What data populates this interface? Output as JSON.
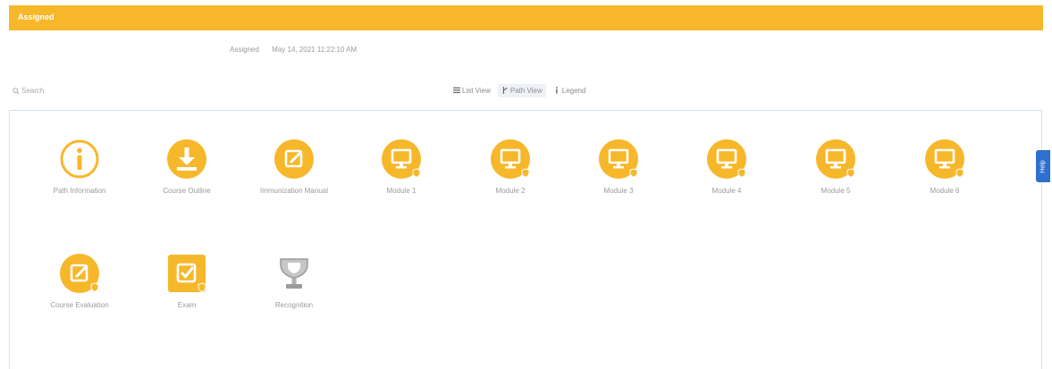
{
  "header": {
    "title": "Assigned"
  },
  "assigned": {
    "label": "Assigned",
    "value": "May 14, 2021 11:22:10 AM"
  },
  "search": {
    "placeholder": "Search"
  },
  "view_options": [
    {
      "label": "List View",
      "icon": "list-icon"
    },
    {
      "label": "Path View",
      "icon": "path-icon",
      "active": true
    },
    {
      "label": "Legend",
      "icon": "legend-icon"
    }
  ],
  "help": {
    "label": "Help"
  },
  "colors": {
    "accent": "#f7b72a",
    "help": "#2f6fcf",
    "trophy": "#b8b8b8"
  },
  "path_items": [
    {
      "label": "Path Information",
      "icon": "info-icon"
    },
    {
      "label": "Course Outline",
      "icon": "download-icon"
    },
    {
      "label": "Immunization Manual",
      "icon": "edit-icon"
    },
    {
      "label": "Module 1",
      "icon": "monitor-icon",
      "badge": "required-badge"
    },
    {
      "label": "Module 2",
      "icon": "monitor-icon",
      "badge": "required-badge"
    },
    {
      "label": "Module 3",
      "icon": "monitor-icon",
      "badge": "required-badge"
    },
    {
      "label": "Module 4",
      "icon": "monitor-icon",
      "badge": "required-badge"
    },
    {
      "label": "Module 5",
      "icon": "monitor-icon",
      "badge": "required-badge"
    },
    {
      "label": "Module 6",
      "icon": "monitor-icon",
      "badge": "required-badge"
    },
    {
      "label": "Course Evaluation",
      "icon": "edit-icon",
      "badge": "required-badge"
    },
    {
      "label": "Exam",
      "icon": "checkbox-icon",
      "badge": "required-badge"
    },
    {
      "label": "Recognition",
      "icon": "trophy-icon"
    }
  ]
}
